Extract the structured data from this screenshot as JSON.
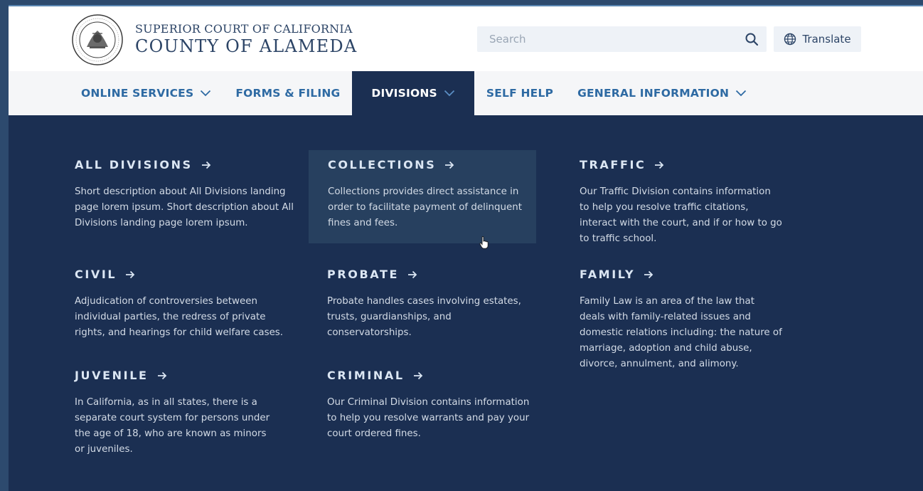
{
  "header": {
    "court_line1": "SUPERIOR COURT OF CALIFORNIA",
    "court_line2": "COUNTY OF ALAMEDA",
    "seal_icon": "court-seal",
    "search": {
      "placeholder": "Search",
      "icon": "search-icon"
    },
    "translate": {
      "label": "Translate",
      "icon": "globe-icon"
    }
  },
  "nav": {
    "items": [
      {
        "label": "ONLINE SERVICES",
        "has_dropdown": true
      },
      {
        "label": "FORMS & FILING",
        "has_dropdown": false
      },
      {
        "label": "DIVISIONS",
        "has_dropdown": true,
        "active": true
      },
      {
        "label": "SELF HELP",
        "has_dropdown": false
      },
      {
        "label": "GENERAL INFORMATION",
        "has_dropdown": true
      }
    ]
  },
  "menu": {
    "items": [
      {
        "title": "ALL DIVISIONS",
        "description": "Short description about All Divisions landing page lorem ipsum. Short description about All Divisions landing page lorem ipsum."
      },
      {
        "title": "COLLECTIONS",
        "description": "Collections provides direct assistance in order to facilitate payment of delinquent fines and fees.",
        "hovered": true
      },
      {
        "title": "TRAFFIC",
        "description": "Our Traffic Division contains information to help you resolve traffic citations, interact with the court, and if or how to go to traffic school."
      },
      {
        "title": "CIVIL",
        "description": "Adjudication of controversies between individual parties, the redress of private rights, and hearings for child welfare cases."
      },
      {
        "title": "PROBATE",
        "description": "Probate handles cases involving estates, trusts, guardianships, and conservatorships."
      },
      {
        "title": "FAMILY",
        "description": "Family Law is an area of the law that deals with family-related issues and domestic relations including: the nature of marriage, adoption and child abuse, divorce, annulment, and alimony."
      },
      {
        "title": "JUVENILE",
        "description": "In California, as in all states, there is a separate court system for persons under the age of 18, who are known as minors or juveniles."
      },
      {
        "title": "CRIMINAL",
        "description": "Our Criminal Division contains information to help you resolve warrants and pay your court ordered fines."
      }
    ]
  },
  "colors": {
    "navy": "#1b2f52",
    "nav_text": "#2e6aa3",
    "brand_text": "#2c4466",
    "hover_bg": "#27405f"
  }
}
